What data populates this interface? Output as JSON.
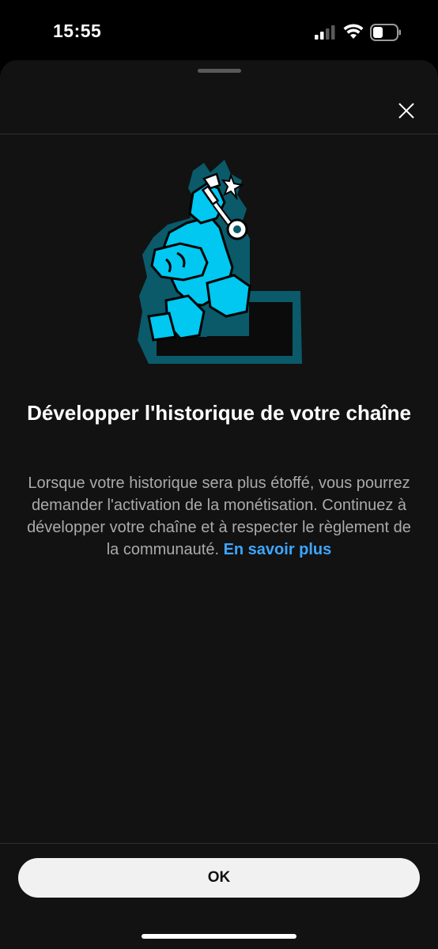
{
  "status_bar": {
    "time": "15:55",
    "icons": [
      "signal-icon",
      "wifi-icon",
      "battery-icon"
    ]
  },
  "sheet": {
    "close_icon": "close-icon",
    "illustration": "key-climbing-stairs-illustration",
    "title": "Développer l'historique de votre chaîne",
    "body": "Lorsque votre historique sera plus étoffé, vous pourrez demander l'activation de la monétisation. Continuez à développer votre chaîne et à respecter le règlement de la communauté.",
    "learn_more_label": "En savoir plus",
    "ok_label": "OK"
  },
  "colors": {
    "background": "#000000",
    "sheet_background": "#121212",
    "title_text": "#ffffff",
    "body_text": "#aaaaaa",
    "link": "#3ea6ff",
    "button_background": "#f1f1f1",
    "button_text": "#0f0f0f",
    "illustration_cyan": "#00c8f0",
    "illustration_teal": "#0a5a6a"
  }
}
